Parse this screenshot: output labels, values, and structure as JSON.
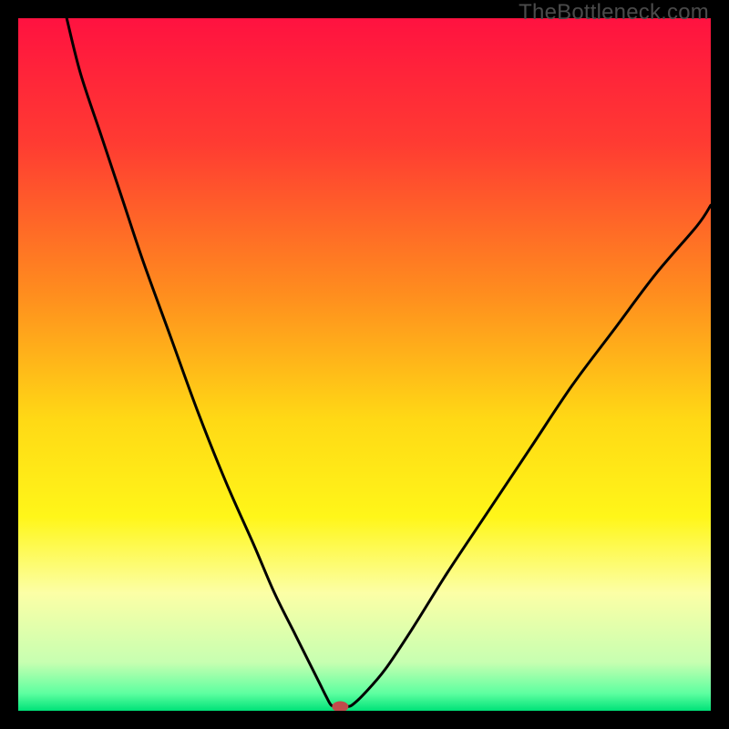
{
  "watermark": "TheBottleneck.com",
  "chart_data": {
    "type": "line",
    "title": "",
    "xlabel": "",
    "ylabel": "",
    "xlim": [
      0,
      100
    ],
    "ylim": [
      0,
      100
    ],
    "background_gradient": {
      "stops": [
        {
          "pos": 0.0,
          "color": "#ff1240"
        },
        {
          "pos": 0.18,
          "color": "#ff3b32"
        },
        {
          "pos": 0.4,
          "color": "#ff8e1e"
        },
        {
          "pos": 0.58,
          "color": "#ffd915"
        },
        {
          "pos": 0.72,
          "color": "#fff619"
        },
        {
          "pos": 0.83,
          "color": "#fcffa6"
        },
        {
          "pos": 0.93,
          "color": "#c7ffb1"
        },
        {
          "pos": 0.975,
          "color": "#5dffa0"
        },
        {
          "pos": 1.0,
          "color": "#00e278"
        }
      ]
    },
    "series": [
      {
        "name": "bottleneck-curve",
        "color": "#000000",
        "x": [
          7,
          9,
          12,
          15,
          18,
          22,
          26,
          30,
          34,
          37,
          40,
          42,
          43.5,
          44.5,
          45.2,
          46.0,
          47.5,
          48.3,
          50,
          53,
          57,
          62,
          68,
          74,
          80,
          86,
          92,
          98,
          100
        ],
        "y": [
          100,
          92,
          83,
          74,
          65,
          54,
          43,
          33,
          24,
          17,
          11,
          7,
          4,
          2,
          0.8,
          0.6,
          0.6,
          0.9,
          2.5,
          6,
          12,
          20,
          29,
          38,
          47,
          55,
          63,
          70,
          73
        ]
      }
    ],
    "marker": {
      "name": "optimum-marker",
      "x": 46.5,
      "y": 0.6,
      "color": "#c14b4b",
      "rx": 9,
      "ry": 6
    }
  }
}
